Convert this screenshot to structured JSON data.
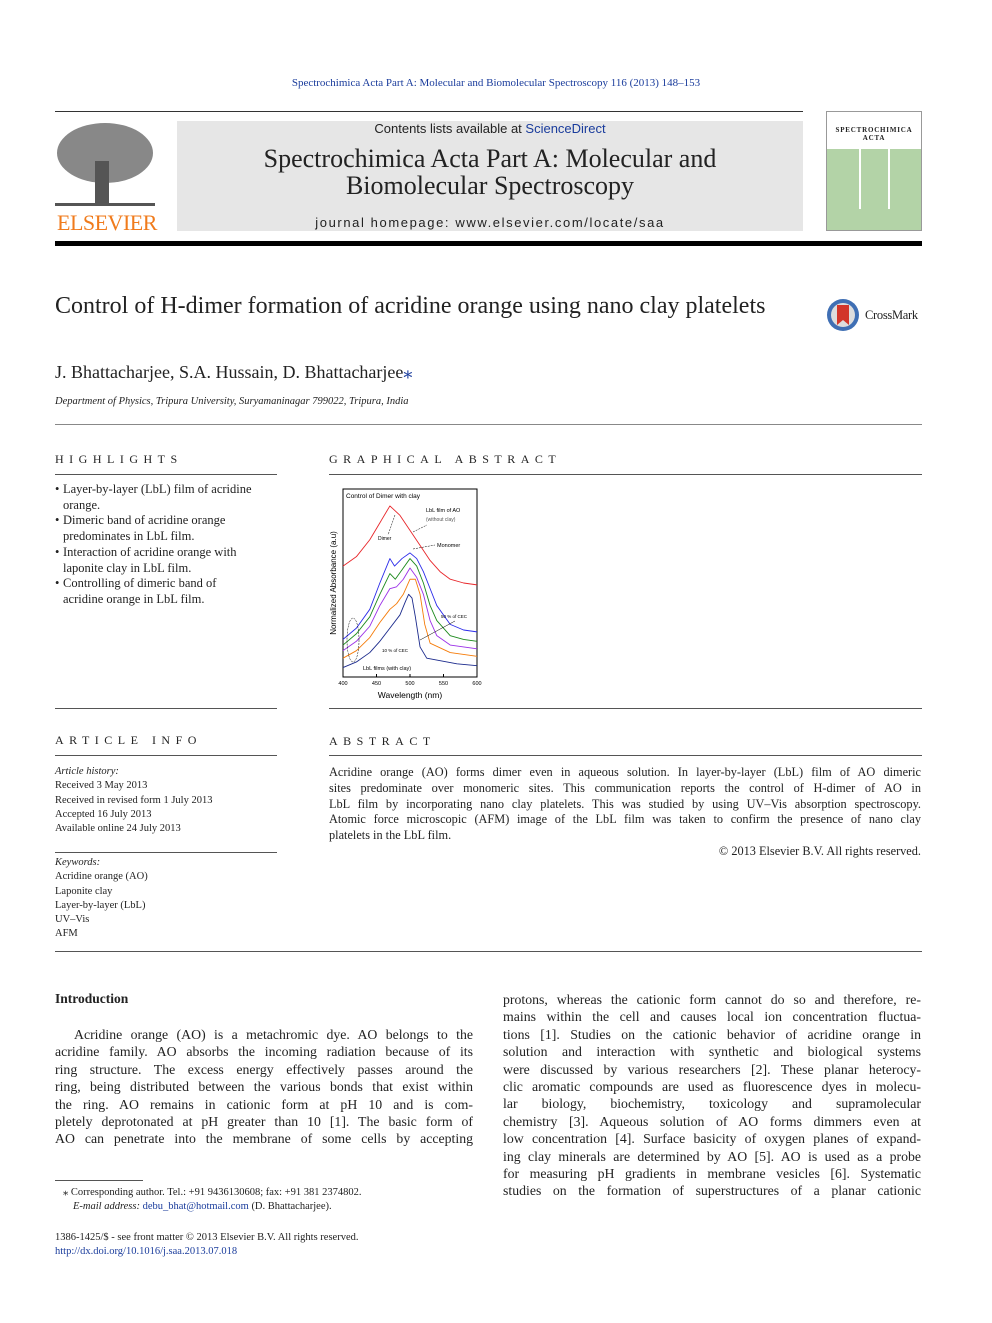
{
  "journal_ref": "Spectrochimica Acta Part A: Molecular and Biomolecular Spectroscopy 116 (2013) 148–153",
  "header": {
    "contents_prefix": "Contents lists available at ",
    "contents_link": "ScienceDirect",
    "journal_title_1": "Spectrochimica Acta Part A: Molecular and",
    "journal_title_2": "Biomolecular Spectroscopy",
    "homepage": "journal homepage: www.elsevier.com/locate/saa",
    "publisher": "ELSEVIER",
    "cover_title_1": "SPECTROCHIMICA",
    "cover_title_2": "ACTA"
  },
  "crossmark": "CrossMark",
  "article": {
    "title": "Control of H-dimer formation of acridine orange using nano clay platelets",
    "authors": "J. Bhattacharjee, S.A. Hussain, D. Bhattacharjee",
    "author_mark": "⁎",
    "affiliation": "Department of Physics, Tripura University, Suryamaninagar 799022, Tripura, India"
  },
  "highlights": {
    "heading": "Highlights",
    "items": [
      [
        "Layer-by-layer (LbL) film of acridine",
        "orange."
      ],
      [
        "Dimeric band of acridine orange",
        "predominates in LbL film."
      ],
      [
        "Interaction of acridine orange with",
        "laponite clay in LbL film."
      ],
      [
        "Controlling of dimeric band of",
        "acridine orange in LbL film."
      ]
    ]
  },
  "graphical_abstract": {
    "heading": "Graphical abstract"
  },
  "chart_data": {
    "type": "line",
    "title": "Control of Dimer with clay",
    "xlabel": "Wavelength (nm)",
    "ylabel": "Normalized Absorbance (a.u)",
    "xlim": [
      400,
      600
    ],
    "xticks": [
      "400",
      "450",
      "500",
      "550",
      "600"
    ],
    "annotations": [
      "LbL film of AO",
      "(without clay)",
      "Dimer",
      "Monomer",
      "50 % of CEC",
      "10 % of CEC",
      "LbL films (with clay)"
    ],
    "grid": false,
    "series": [
      {
        "color": "#e8262a",
        "x": [
          400,
          420,
          440,
          455,
          470,
          485,
          500,
          515,
          530,
          545,
          560,
          580,
          600
        ],
        "y": [
          0.59,
          0.64,
          0.73,
          0.82,
          0.91,
          0.86,
          0.78,
          0.7,
          0.62,
          0.56,
          0.52,
          0.5,
          0.49
        ]
      },
      {
        "color": "#2b2bea",
        "x": [
          400,
          420,
          440,
          455,
          470,
          477,
          488,
          500,
          510,
          520,
          530,
          540,
          560,
          580,
          600
        ],
        "y": [
          0.2,
          0.26,
          0.36,
          0.5,
          0.63,
          0.59,
          0.63,
          0.66,
          0.63,
          0.56,
          0.47,
          0.38,
          0.28,
          0.25,
          0.24
        ]
      },
      {
        "color": "#1c8a1c",
        "x": [
          400,
          420,
          440,
          455,
          470,
          478,
          488,
          500,
          510,
          520,
          530,
          540,
          560,
          580,
          600
        ],
        "y": [
          0.17,
          0.23,
          0.32,
          0.44,
          0.55,
          0.52,
          0.57,
          0.63,
          0.59,
          0.5,
          0.38,
          0.3,
          0.22,
          0.2,
          0.19
        ]
      },
      {
        "color": "#9b30e8",
        "x": [
          400,
          420,
          440,
          455,
          470,
          480,
          490,
          500,
          510,
          520,
          530,
          540,
          560,
          580,
          600
        ],
        "y": [
          0.14,
          0.19,
          0.27,
          0.38,
          0.47,
          0.48,
          0.52,
          0.58,
          0.53,
          0.44,
          0.3,
          0.22,
          0.17,
          0.16,
          0.15
        ]
      },
      {
        "color": "#f57c0a",
        "x": [
          400,
          420,
          440,
          455,
          470,
          480,
          490,
          500,
          508,
          515,
          522,
          530,
          560,
          580,
          600
        ],
        "y": [
          0.1,
          0.14,
          0.21,
          0.29,
          0.36,
          0.39,
          0.44,
          0.52,
          0.52,
          0.44,
          0.28,
          0.18,
          0.13,
          0.12,
          0.11
        ]
      },
      {
        "color": "#1b2a8c",
        "x": [
          400,
          420,
          440,
          455,
          470,
          485,
          493,
          498,
          503,
          508,
          515,
          525,
          540,
          570,
          600
        ],
        "y": [
          0.05,
          0.08,
          0.13,
          0.19,
          0.26,
          0.33,
          0.4,
          0.44,
          0.42,
          0.32,
          0.16,
          0.1,
          0.09,
          0.07,
          0.06
        ]
      }
    ]
  },
  "article_info": {
    "heading": "Article info",
    "history_label": "Article history:",
    "history": [
      "Received 3 May 2013",
      "Received in revised form 1 July 2013",
      "Accepted 16 July 2013",
      "Available online 24 July 2013"
    ],
    "keywords_label": "Keywords:",
    "keywords": [
      "Acridine orange (AO)",
      "Laponite clay",
      "Layer-by-layer (LbL)",
      "UV–Vis",
      "AFM"
    ]
  },
  "abstract": {
    "heading": "Abstract",
    "lines": [
      "Acridine orange (AO) forms dimer even in aqueous solution. In layer-by-layer (LbL) film of AO dimeric",
      "sites predominate over monomeric sites. This communication reports the control of H-dimer of AO in",
      "LbL film by incorporating nano clay platelets. This was studied by using UV–Vis absorption spectroscopy.",
      "Atomic force microscopic (AFM) image of the LbL film was taken to confirm the presence of nano clay",
      "platelets in the LbL film."
    ],
    "copyright": "© 2013 Elsevier B.V. All rights reserved."
  },
  "intro": {
    "heading": "Introduction",
    "left": [
      "Acridine orange (AO) is a metachromic dye. AO belongs to the",
      "acridine family. AO absorbs the incoming radiation because of its",
      "ring structure. The excess energy effectively passes around the",
      "ring, being distributed between the various bonds that exist within",
      "the ring. AO remains in cationic form at pH 10 and is com-",
      "pletely deprotonated at pH greater than 10 [1]. The basic form of",
      "AO can penetrate into the membrane of some cells by accepting"
    ],
    "right": [
      "protons, whereas the cationic form cannot do so and therefore, re-",
      "mains within the cell and causes local ion concentration fluctua-",
      "tions [1]. Studies on the cationic behavior of acridine orange in",
      "solution and interaction with synthetic and biological systems",
      "were discussed by various researchers [2]. These planar heterocy-",
      "clic aromatic compounds are used as fluorescence dyes in molecu-",
      "lar biology, biochemistry, toxicology and supramolecular",
      "chemistry [3]. Aqueous solution of AO forms dimmers even at",
      "low concentration [4]. Surface basicity of oxygen planes of expand-",
      "ing clay minerals are determined by AO [5]. AO is used as a probe",
      "for measuring pH gradients in membrane vesicles [6]. Systematic",
      "studies on the formation of superstructures of a planar cationic"
    ]
  },
  "footnote": {
    "corresponding": "⁎ Corresponding author. Tel.: +91 9436130608; fax: +91 381 2374802.",
    "email_label": "E-mail address: ",
    "email": "debu_bhat@hotmail.com",
    "email_suffix": " (D. Bhattacharjee)."
  },
  "footer": {
    "issn": "1386-1425/$ - see front matter © 2013 Elsevier B.V. All rights reserved.",
    "doi": "http://dx.doi.org/10.1016/j.saa.2013.07.018"
  }
}
